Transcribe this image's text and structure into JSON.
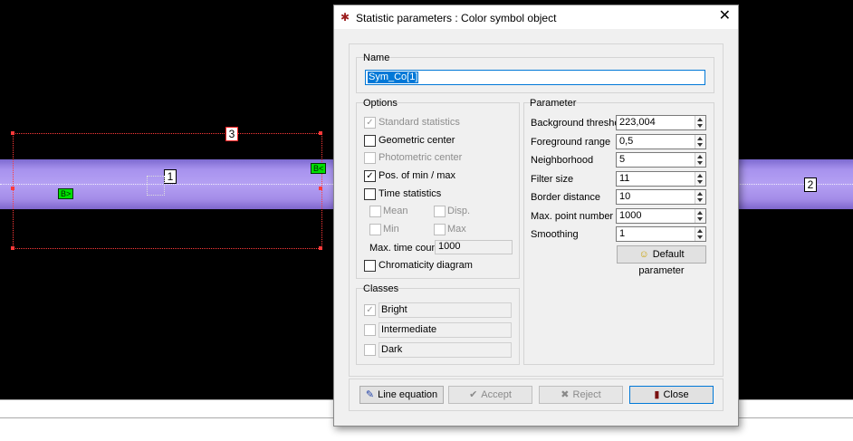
{
  "canvas": {
    "marker_1": "1",
    "marker_2": "2",
    "marker_3": "3",
    "tag_a": "B>",
    "tag_b": "B<"
  },
  "dialog": {
    "title": "Statistic parameters : Color symbol object",
    "name_group": {
      "label": "Name",
      "value": "Sym_Co[1]"
    },
    "options": {
      "label": "Options",
      "standard_statistics": "Standard statistics",
      "geometric_center": "Geometric center",
      "photometric_center": "Photometric center",
      "pos_min_max": "Pos. of min / max",
      "time_statistics": "Time statistics",
      "mean": "Mean",
      "disp": "Disp.",
      "min": "Min",
      "max": "Max",
      "max_time_count_label": "Max. time count",
      "max_time_count_value": "1000",
      "chromaticity_diagram": "Chromaticity diagram"
    },
    "classes": {
      "label": "Classes",
      "bright": "Bright",
      "intermediate": "Intermediate",
      "dark": "Dark"
    },
    "parameter": {
      "label": "Parameter",
      "background_threshold_label": "Background threshold",
      "background_threshold_value": "223,004",
      "foreground_range_label": "Foreground range",
      "foreground_range_value": "0,5",
      "neighborhood_label": "Neighborhood",
      "neighborhood_value": "5",
      "filter_size_label": "Filter size",
      "filter_size_value": "11",
      "border_distance_label": "Border distance",
      "border_distance_value": "10",
      "max_point_number_label": "Max. point number",
      "max_point_number_value": "1000",
      "smoothing_label": "Smoothing",
      "smoothing_value": "1",
      "default_button": "Default parameter"
    },
    "buttons": {
      "line_equation": "Line equation",
      "accept": "Accept",
      "reject": "Reject",
      "close": "Close"
    },
    "checks": {
      "check": "✓"
    }
  }
}
